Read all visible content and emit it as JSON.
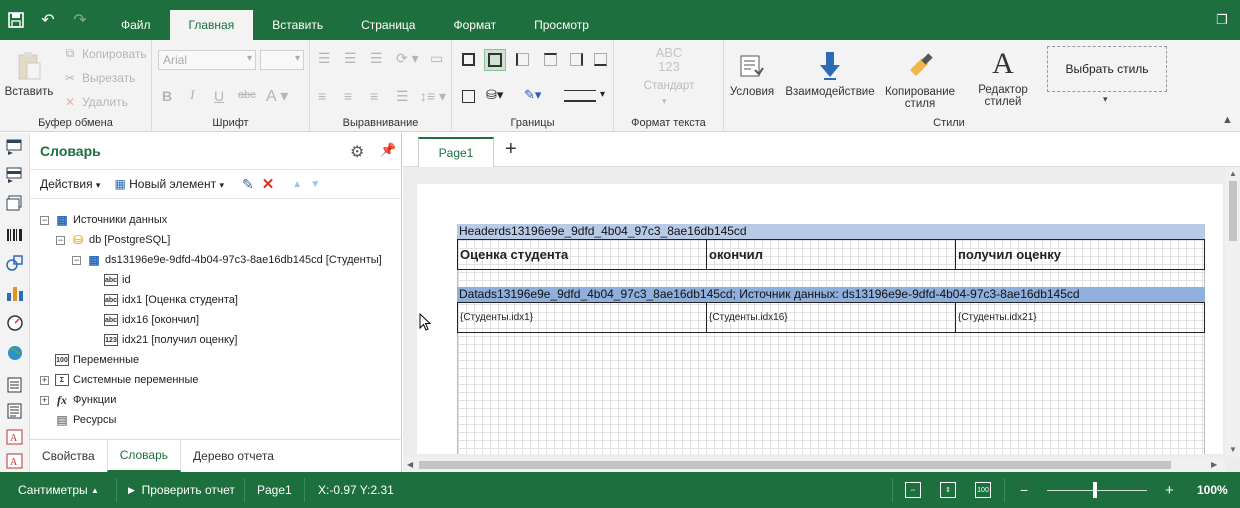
{
  "menu": {
    "tabs": [
      "Файл",
      "Главная",
      "Вставить",
      "Страница",
      "Формат",
      "Просмотр"
    ],
    "active": "Главная"
  },
  "ribbon": {
    "clipboard": {
      "label": "Буфер обмена",
      "paste": "Вставить",
      "copy": "Копировать",
      "cut": "Вырезать",
      "delete": "Удалить"
    },
    "font": {
      "label": "Шрифт",
      "font_name": "Arial",
      "font_size": ""
    },
    "align": {
      "label": "Выравнивание"
    },
    "borders": {
      "label": "Границы"
    },
    "text_format": {
      "label": "Формат текста",
      "preview": "ABC\n123",
      "standard": "Стандарт"
    },
    "styles": {
      "label": "Стили",
      "conditions": "Условия",
      "interaction": "Взаимодействие",
      "copy_style_1": "Копирование",
      "copy_style_2": "стиля",
      "editor_1": "Редактор",
      "editor_2": "стилей",
      "choose_style": "Выбрать стиль"
    }
  },
  "dictionary": {
    "title": "Словарь",
    "actions": "Действия",
    "new_element": "Новый элемент",
    "tree": {
      "data_sources": "Источники данных",
      "db": "db [PostgreSQL]",
      "ds": "ds13196e9e-9dfd-4b04-97c3-8ae16db145cd [Студенты]",
      "col_id": "id",
      "col_idx1": "idx1 [Оценка студента]",
      "col_idx16": "idx16 [окончил]",
      "col_idx21": "idx21 [получил оценку]",
      "variables": "Переменные",
      "system_variables": "Системные переменные",
      "functions": "Функции",
      "resources": "Ресурсы"
    },
    "tabs": [
      "Свойства",
      "Словарь",
      "Дерево отчета"
    ],
    "active_tab": "Словарь"
  },
  "report": {
    "page_tab": "Page1",
    "header_band": "Headerds13196e9e_9dfd_4b04_97c3_8ae16db145cd",
    "header_cells": [
      "Оценка студента",
      "окончил",
      "получил оценку"
    ],
    "data_band": "Datads13196e9e_9dfd_4b04_97c3_8ae16db145cd; Источник данных: ds13196e9e-9dfd-4b04-97c3-8ae16db145cd",
    "data_cells": [
      "{Студенты.idx1}",
      "{Студенты.idx16}",
      "{Студенты.idx21}"
    ],
    "header_band_color": "#b8cbe6",
    "data_band_color": "#8fb0dd"
  },
  "status": {
    "units": "Сантиметры",
    "check": "Проверить отчет",
    "page": "Page1",
    "coords": "X:-0.97 Y:2.31",
    "zoom": "100%",
    "zoom_minus": "−",
    "zoom_plus": "+"
  },
  "colors": {
    "accent": "#1e6f3e"
  }
}
